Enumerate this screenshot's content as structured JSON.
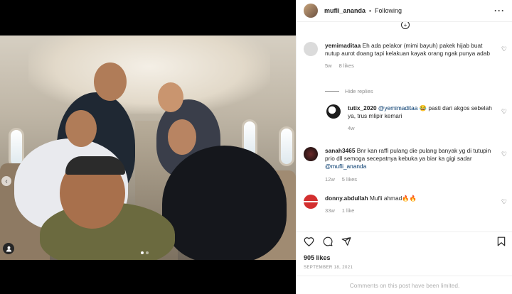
{
  "post": {
    "username": "mufli_ananda",
    "separator": "•",
    "follow_status": "Following",
    "more_icon": "more-horizontal-icon"
  },
  "comments": [
    {
      "username": "yemimaditaa",
      "text": "Eh ada pelakor (mimi bayuh) pakek hijab buat nutup aurot doang tapi kelakuan kayak orang ngak punya adab",
      "age": "5w",
      "likes": "8 likes"
    },
    {
      "hide_replies": "Hide replies"
    },
    {
      "username": "tutix_2020",
      "mention": "@yemimaditaa",
      "text": "😂 pasti dari akgos sebelah ya, trus mlipir kemari",
      "age": "4w"
    },
    {
      "username": "sanah3465",
      "text": "Bnr kan raffi pulang die pulang banyak yg di tutupin prio dll semoga secepatnya kebuka ya biar ka gigi sadar",
      "mention": "@mufli_ananda",
      "age": "12w",
      "likes": "5 likes"
    },
    {
      "username": "donny.abdullah",
      "text": "Mufli ahmad🔥🔥",
      "age": "33w",
      "likes": "1 like"
    }
  ],
  "footer": {
    "likes": "905 likes",
    "date": "SEPTEMBER 18, 2021",
    "comments_limited": "Comments on this post have been limited."
  },
  "colors": {
    "text": "#262626",
    "muted": "#8e8e8e",
    "mention": "#00376b",
    "border": "#efefef"
  }
}
